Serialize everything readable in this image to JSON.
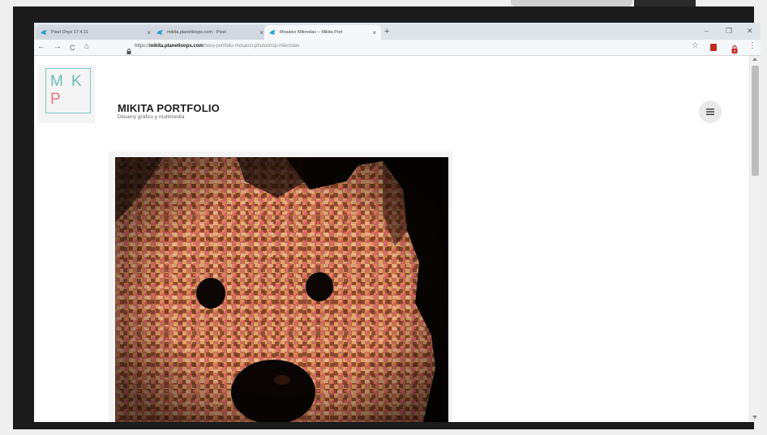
{
  "browser": {
    "tabs": [
      {
        "title": "Pixel Onyx 17.4.11",
        "active": false
      },
      {
        "title": "mikita.planetloops.com - Pixel",
        "active": false
      },
      {
        "title": "Mosaico Mikroslav – Mikita Port",
        "active": true
      }
    ],
    "new_tab_symbol": "+",
    "window_controls": {
      "minimize": "–",
      "maximize": "❐",
      "close": "✕"
    },
    "nav": {
      "back": "←",
      "forward": "→",
      "reload": "C",
      "home": "⌂"
    },
    "url": {
      "scheme": "https://",
      "host": "mikita.planetloops.com",
      "path": "/hora-portfolio-mosaico-photoshop-mikroslav"
    },
    "icons": {
      "star": "star-icon",
      "extension": "pdf-extension-icon",
      "lock_extension": "lock-extension-icon",
      "menu": "kebab-menu-icon"
    }
  },
  "site": {
    "logo_letters": {
      "m": "M",
      "k": "K",
      "p": "P"
    },
    "title": "MIKITA PORTFOLIO",
    "subtitle": "Disseny gràfics y multimedia",
    "menu_icon": "hamburger-icon"
  },
  "content": {
    "image_description_icon": "mosaic-photo"
  },
  "colors": {
    "logo_teal": "#6cbcb7",
    "logo_coral": "#e27a77",
    "tab_bar": "#dfe3ea"
  }
}
